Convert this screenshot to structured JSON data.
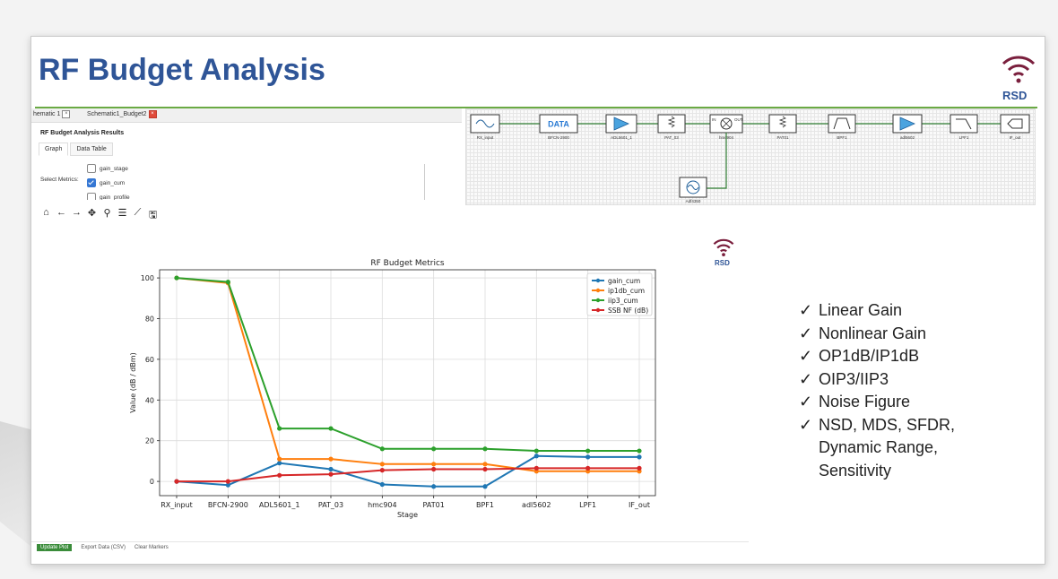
{
  "slide": {
    "title": "RF Budget Analysis"
  },
  "logo": {
    "text": "RSD"
  },
  "tabs": [
    {
      "label": "hematic 1"
    },
    {
      "label": "Schematic1_Budget2"
    }
  ],
  "results": {
    "title": "RF Budget Analysis Results",
    "subtabs": [
      "Graph",
      "Data Table"
    ],
    "select_label": "Select Metrics:",
    "metrics": [
      {
        "label": "gain_stage",
        "checked": false
      },
      {
        "label": "gain_cum",
        "checked": true
      },
      {
        "label": "gain_profile",
        "checked": false
      }
    ]
  },
  "toolbar": {
    "icons": [
      "home-icon",
      "back-arrow-icon",
      "forward-arrow-icon",
      "pan-icon",
      "zoom-icon",
      "configure-icon",
      "edit-axis-icon",
      "save-icon"
    ],
    "glyphs": [
      "⌂",
      "←",
      "→",
      "✥",
      "⚲",
      "☰",
      "⟋",
      "🖫"
    ]
  },
  "schematic": {
    "blocks": [
      "RX_input",
      "BFCN-2900",
      "ADL5601_1",
      "PAT_03",
      "hmc904",
      "PAT01",
      "BPF1",
      "adl5602",
      "LPF1",
      "IF_out"
    ],
    "data_label": "DATA",
    "mixer_in": "IN",
    "mixer_out": "OUT",
    "lo_label": "Adf4350"
  },
  "chart_data": {
    "type": "line",
    "title": "RF Budget Metrics",
    "xlabel": "Stage",
    "ylabel": "Value (dB / dBm)",
    "ylim": [
      -7,
      104
    ],
    "yticks": [
      0,
      20,
      40,
      60,
      80,
      100
    ],
    "grid": true,
    "legend": "top-right",
    "categories": [
      "RX_input",
      "BFCN-2900",
      "ADL5601_1",
      "PAT_03",
      "hmc904",
      "PAT01",
      "BPF1",
      "adl5602",
      "LPF1",
      "IF_out"
    ],
    "series": [
      {
        "name": "gain_cum",
        "color": "#1f77b4",
        "values": [
          0,
          -1.8,
          9,
          6,
          -1.5,
          -2.5,
          -2.5,
          12.5,
          12,
          12
        ]
      },
      {
        "name": "ip1db_cum",
        "color": "#ff7f0e",
        "values": [
          100,
          97.5,
          11,
          11,
          8.5,
          8.5,
          8.5,
          5,
          5,
          5
        ]
      },
      {
        "name": "iip3_cum",
        "color": "#2ca02c",
        "values": [
          100,
          98,
          26,
          26,
          16,
          16,
          16,
          15,
          15,
          15
        ]
      },
      {
        "name": "SSB NF (dB)",
        "color": "#d62728",
        "values": [
          0,
          0,
          3,
          3.5,
          5.5,
          6,
          6,
          6.5,
          6.5,
          6.5
        ]
      }
    ]
  },
  "checklist": {
    "mark": "✓",
    "items": [
      "Linear Gain",
      "Nonlinear Gain",
      "OP1dB/IP1dB",
      "OIP3/IIP3",
      "Noise Figure",
      "NSD, MDS, SFDR,",
      "Dynamic Range,",
      "Sensitivity"
    ]
  },
  "footer": {
    "buttons": [
      "Update Plot",
      "Export Data (CSV)",
      "Clear Markers"
    ]
  }
}
